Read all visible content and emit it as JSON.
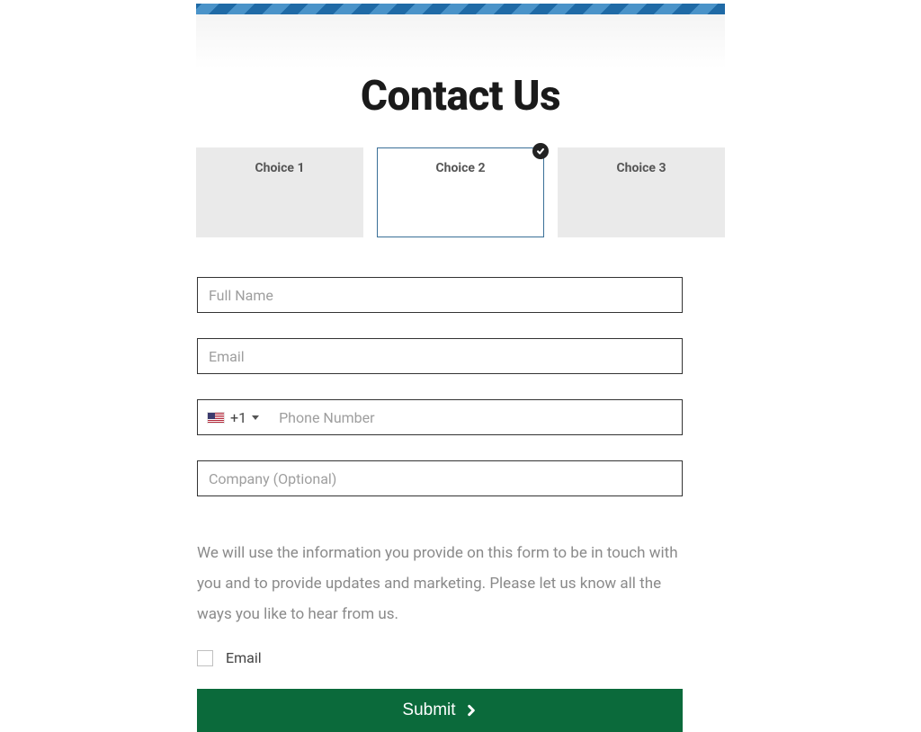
{
  "page": {
    "title": "Contact Us"
  },
  "choices": [
    {
      "label": "Choice 1",
      "selected": false
    },
    {
      "label": "Choice 2",
      "selected": true
    },
    {
      "label": "Choice 3",
      "selected": false
    }
  ],
  "form": {
    "full_name": {
      "placeholder": "Full Name",
      "value": ""
    },
    "email": {
      "placeholder": "Email",
      "value": ""
    },
    "phone": {
      "country_code": "+1",
      "placeholder": "Phone Number",
      "value": ""
    },
    "company": {
      "placeholder": "Company (Optional)",
      "value": ""
    }
  },
  "consent": {
    "text": "We will use the information you provide on this form to be in touch with you and to provide updates and marketing. Please let us know all the ways you like to hear from us.",
    "checkbox_label": "Email",
    "checked": false
  },
  "submit_label": "Submit"
}
